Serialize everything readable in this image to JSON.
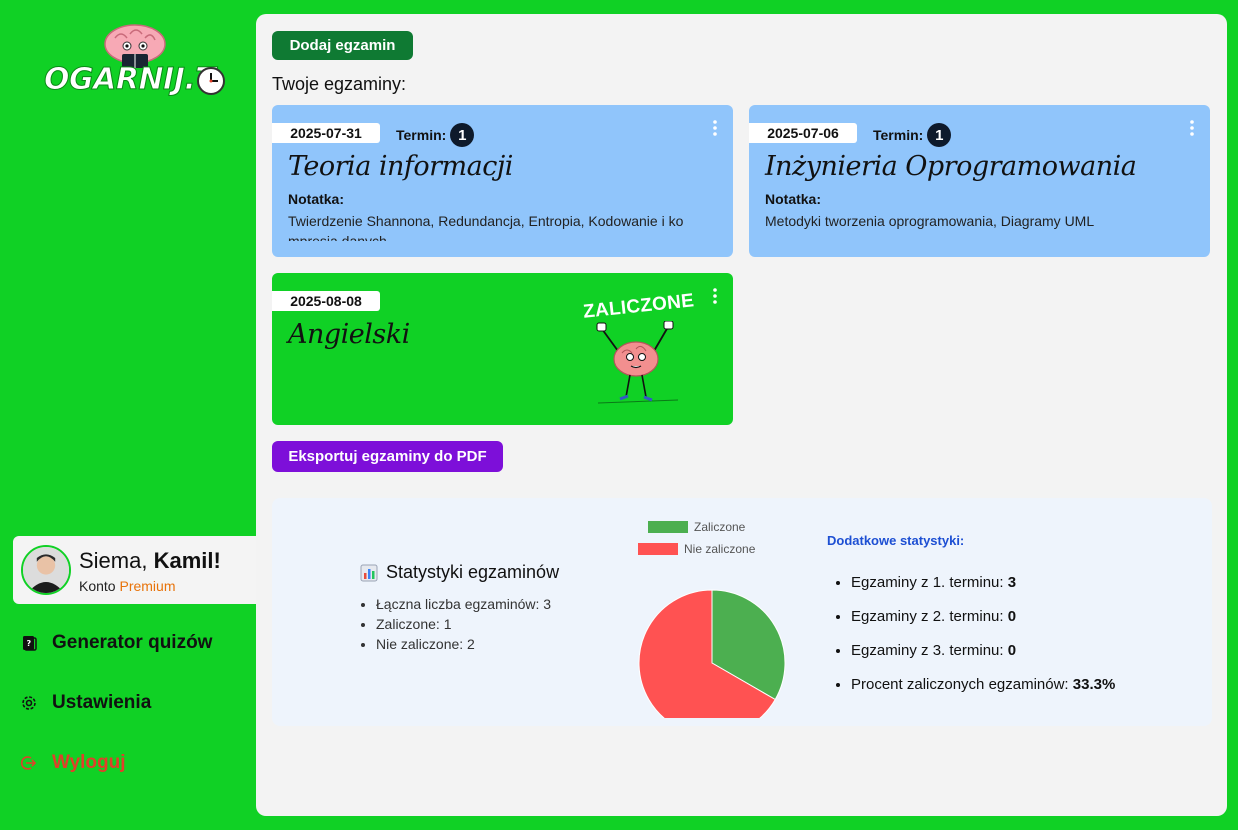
{
  "brand": {
    "logo_text": "OGARNIJ.T",
    "logo_alt": "logo"
  },
  "user": {
    "greeting": "Siema,",
    "name": "Kamil!",
    "account_label": "Konto",
    "account_type": "Premium"
  },
  "nav": {
    "quiz": "Generator quizów",
    "settings": "Ustawienia",
    "logout": "Wyloguj"
  },
  "actions": {
    "add_exam": "Dodaj egzamin",
    "export_pdf": "Eksportuj egzaminy do PDF"
  },
  "exams_heading": "Twoje egzaminy:",
  "exams": [
    {
      "date": "2025-07-31",
      "term_label": "Termin:",
      "term": "1",
      "title": "Teoria informacji",
      "note_label": "Notatka:",
      "note": "Twierdzenie Shannona, Redundancja, Entropia, Kodowanie i kompresja danych"
    },
    {
      "date": "2025-07-06",
      "term_label": "Termin:",
      "term": "1",
      "title": "Inżynieria Oprogramowania",
      "note_label": "Notatka:",
      "note": "Metodyki tworzenia oprogramowania, Diagramy UML"
    },
    {
      "date": "2025-08-08",
      "title": "Angielski",
      "status": "ZALICZONE"
    }
  ],
  "stats": {
    "title": "Statystyki egzaminów",
    "items": [
      "Łączna liczba egzaminów: 3",
      "Zaliczone: 1",
      "Nie zaliczone: 2"
    ],
    "extra_title": "Dodatkowe statystyki:",
    "extra": [
      {
        "label": "Egzaminy z 1. terminu:",
        "value": "3"
      },
      {
        "label": "Egzaminy z 2. terminu:",
        "value": "0"
      },
      {
        "label": "Egzaminy z 3. terminu:",
        "value": "0"
      },
      {
        "label": "Procent zaliczonych egzaminów:",
        "value": "33.3%"
      }
    ]
  },
  "chart_data": {
    "type": "pie",
    "categories": [
      "Zaliczone",
      "Nie zaliczone"
    ],
    "values": [
      1,
      2
    ],
    "colors": [
      "#4caf50",
      "#ff5252"
    ],
    "legend": "top"
  },
  "colors": {
    "accent": "#10d125",
    "add_button": "#0f7a33",
    "export_button": "#7d0fd9",
    "card_blue": "#90c5fb",
    "premium": "#e8730a"
  }
}
